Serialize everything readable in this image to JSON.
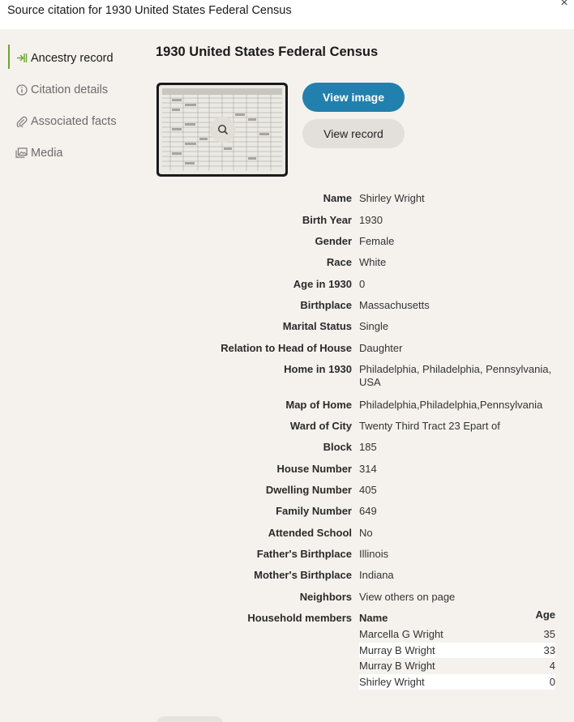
{
  "header": {
    "title": "Source citation for 1930 United States Federal Census",
    "close_icon": "close-icon"
  },
  "sidebar": {
    "items": [
      {
        "label": "Ancestry record",
        "icon": "ancestry-icon",
        "active": true
      },
      {
        "label": "Citation details",
        "icon": "info-icon",
        "active": false
      },
      {
        "label": "Associated facts",
        "icon": "paperclip-icon",
        "active": false
      },
      {
        "label": "Media",
        "icon": "media-icon",
        "active": false
      }
    ]
  },
  "main": {
    "title": "1930 United States Federal Census",
    "view_image_label": "View image",
    "view_record_label": "View record"
  },
  "fields": [
    {
      "label": "Name",
      "value": "Shirley Wright"
    },
    {
      "label": "Birth Year",
      "value": "1930"
    },
    {
      "label": "Gender",
      "value": "Female"
    },
    {
      "label": "Race",
      "value": "White"
    },
    {
      "label": "Age in 1930",
      "value": "0"
    },
    {
      "label": "Birthplace",
      "value": "Massachusetts"
    },
    {
      "label": "Marital Status",
      "value": "Single"
    },
    {
      "label": "Relation to Head of House",
      "value": "Daughter"
    },
    {
      "label": "Home in 1930",
      "value": "Philadelphia, Philadelphia, Pennsylvania, USA"
    },
    {
      "label": "Map of Home",
      "value": "Philadelphia,Philadelphia,Pennsylvania"
    },
    {
      "label": "Ward of City",
      "value": "Twenty Third Tract 23 Epart of"
    },
    {
      "label": "Block",
      "value": "185"
    },
    {
      "label": "House Number",
      "value": "314"
    },
    {
      "label": "Dwelling Number",
      "value": "405"
    },
    {
      "label": "Family Number",
      "value": "649"
    },
    {
      "label": "Attended School",
      "value": "No"
    },
    {
      "label": "Father's Birthplace",
      "value": "Illinois"
    },
    {
      "label": "Mother's Birthplace",
      "value": "Indiana"
    },
    {
      "label": "Neighbors",
      "value": "View others on page"
    }
  ],
  "household": {
    "label": "Household members",
    "col_name": "Name",
    "col_age": "Age",
    "members": [
      {
        "name": "Marcella G Wright",
        "age": "35"
      },
      {
        "name": "Murray B Wright",
        "age": "33"
      },
      {
        "name": "Murray B Wright",
        "age": "4"
      },
      {
        "name": "Shirley Wright",
        "age": "0"
      }
    ]
  },
  "colors": {
    "accent_green": "#6da52f",
    "primary_button": "#2180ad",
    "background": "#f5f2ee"
  }
}
